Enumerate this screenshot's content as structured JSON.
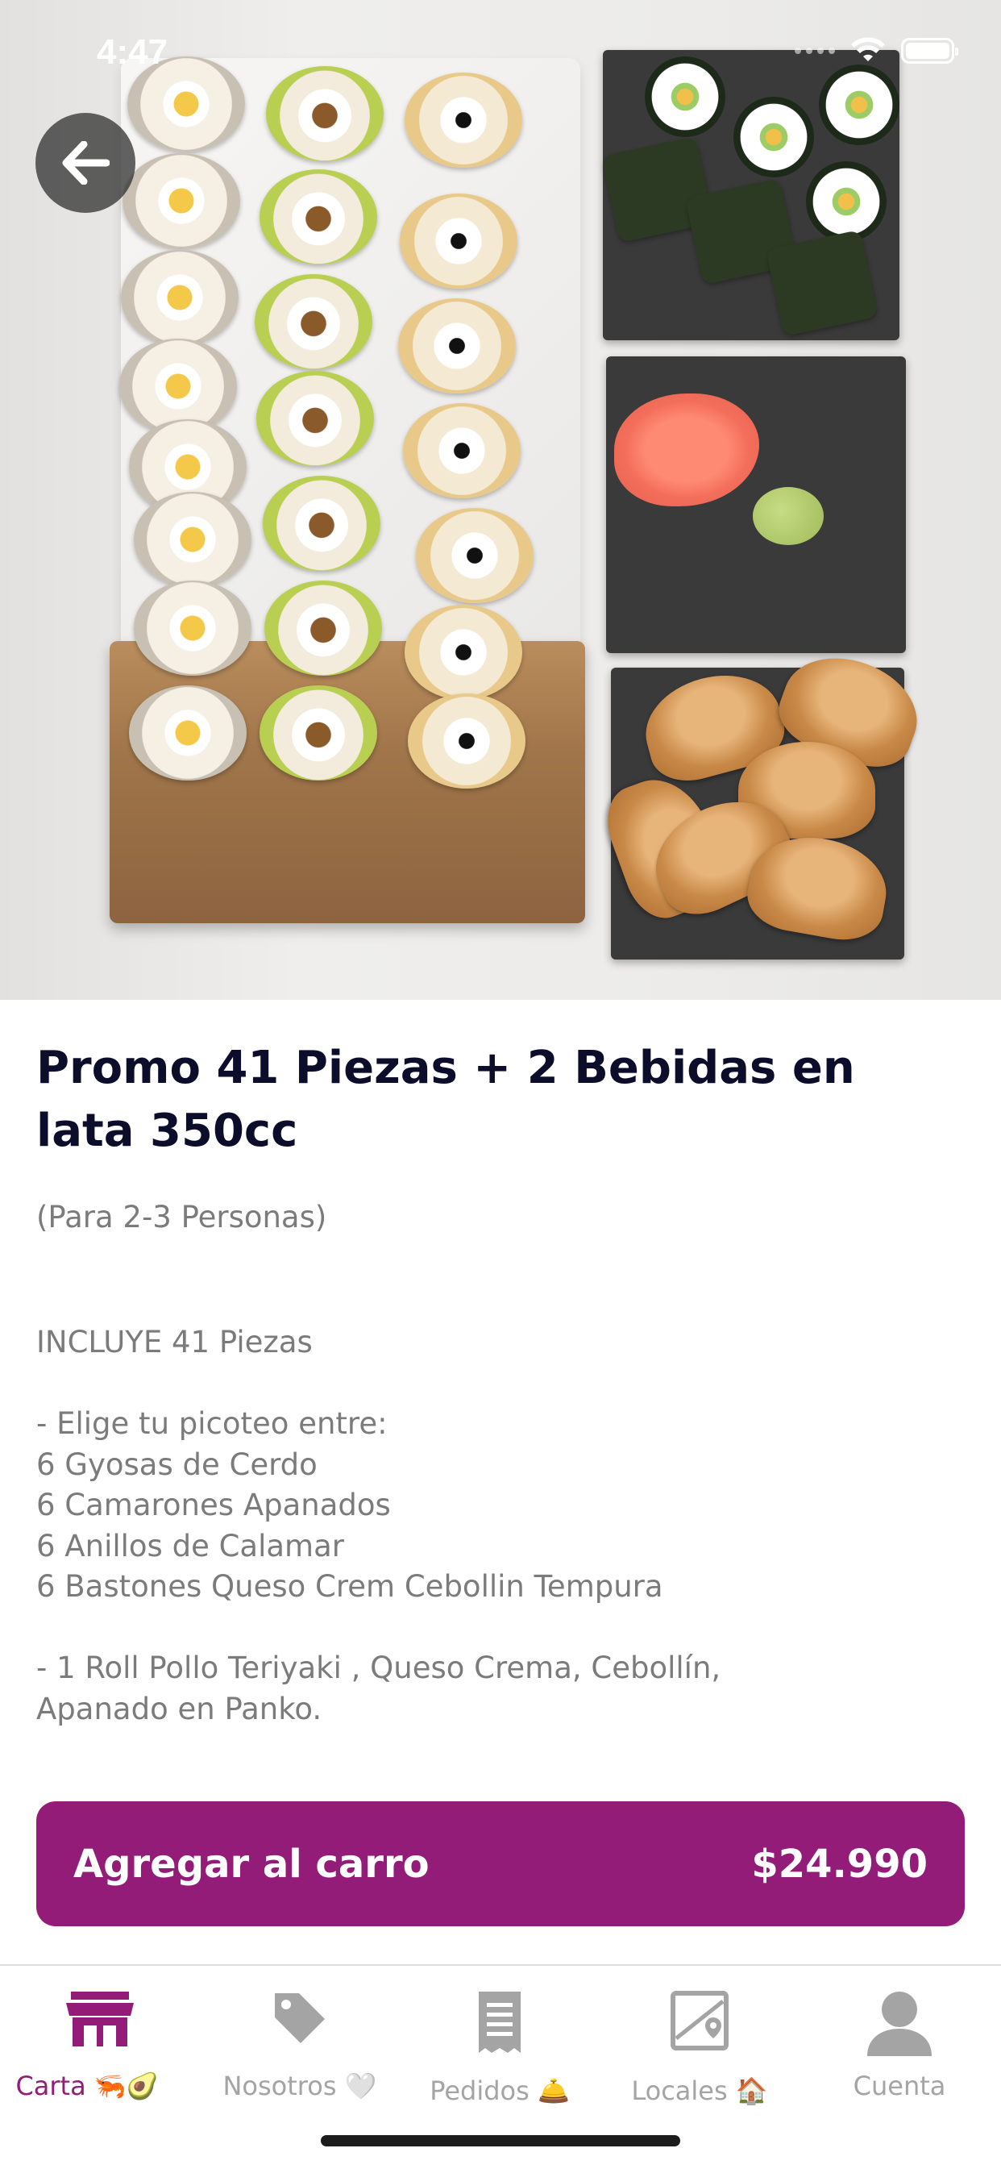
{
  "status_bar": {
    "time": "4:47"
  },
  "product": {
    "title": "Promo 41 Piezas + 2 Bebidas en lata 350cc",
    "subtitle": "(Para 2-3 Personas)",
    "description": "INCLUYE 41  Piezas\n\n- Elige tu picoteo entre:\n6 Gyosas de Cerdo\n6 Camarones Apanados\n6 Anillos de Calamar\n6 Bastones Queso Crem Cebollin Tempura\n\n- 1 Roll Pollo Teriyaki , Queso Crema, Cebollín,\nApanado en Panko."
  },
  "cart_button": {
    "label": "Agregar al carro",
    "price": "$24.990"
  },
  "tabs": [
    {
      "label": "Carta 🦐🥑",
      "icon": "store-icon",
      "active": true
    },
    {
      "label": "Nosotros 🤍",
      "icon": "tag-icon",
      "active": false
    },
    {
      "label": "Pedidos 🛎️",
      "icon": "receipt-icon",
      "active": false
    },
    {
      "label": "Locales 🏠",
      "icon": "map-icon",
      "active": false
    },
    {
      "label": "Cuenta",
      "icon": "person-icon",
      "active": false
    }
  ],
  "colors": {
    "accent": "#931c78",
    "title": "#0c0d2b",
    "body_text": "#7b7b7b",
    "inactive_tab": "#a4a4a4"
  }
}
